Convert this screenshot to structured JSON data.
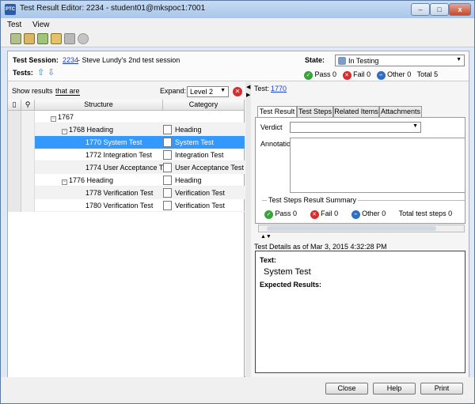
{
  "window": {
    "title": "Test Result Editor: 2234 - student01@mkspoc1:7001",
    "app_icon_label": "PTC",
    "minimize": "–",
    "maximize": "□",
    "close": "x"
  },
  "menu": {
    "items": [
      {
        "label": "Test"
      },
      {
        "label": "View"
      }
    ]
  },
  "toolbar": {
    "icons": [
      "save-icon",
      "open-icon",
      "add-icon",
      "paste-icon",
      "disabled-icon",
      "undo-icon"
    ]
  },
  "header": {
    "session_label": "Test Session:",
    "session_id": "2234",
    "session_desc": " - Steve Lundy's 2nd test session",
    "tests_label": "Tests:",
    "state_label": "State:",
    "state_value": "In Testing",
    "counts": {
      "pass_label": "Pass",
      "pass": "0",
      "fail_label": "Fail",
      "fail": "0",
      "other_label": "Other",
      "other": "0",
      "total_label": "Total",
      "total": "5"
    }
  },
  "left": {
    "show_results_label": "Show results",
    "filter_value": "that are",
    "expand_label": "Expand:",
    "expand_value": "Level 2",
    "columns": {
      "structure": "Structure",
      "category": "Category"
    },
    "rows": [
      {
        "structure": "1767",
        "category": "",
        "expander": "−"
      },
      {
        "structure": "1768 Heading",
        "category": "Heading",
        "expander": "−"
      },
      {
        "structure": "1770 System Test",
        "category": "System Test",
        "expander": ""
      },
      {
        "structure": "1772 Integration Test",
        "category": "Integration Test",
        "expander": ""
      },
      {
        "structure": "1774 User Acceptance T…",
        "category": "User Acceptance Test",
        "expander": ""
      },
      {
        "structure": "1776 Heading",
        "category": "Heading",
        "expander": "−"
      },
      {
        "structure": "1778 Verification Test",
        "category": "Verification Test",
        "expander": ""
      },
      {
        "structure": "1780 Verification Test",
        "category": "Verification Test",
        "expander": ""
      }
    ]
  },
  "right": {
    "test_label": "Test:",
    "test_id": "1770",
    "tabs": [
      "Test Result",
      "Test Steps",
      "Related Items",
      "Attachments"
    ],
    "verdict_label": "Verdict",
    "annotation_label": "Annotation",
    "summary_label": "Test Steps Result Summary",
    "summary": {
      "pass_label": "Pass",
      "pass": "0",
      "fail_label": "Fail",
      "fail": "0",
      "other_label": "Other",
      "other": "0",
      "total_label": "Total test steps",
      "total": "0"
    },
    "details_header": "Test Details as of Mar 3, 2015 4:32:28 PM",
    "text_label": "Text:",
    "text_value": "System Test",
    "expected_label": "Expected Results:"
  },
  "footer": {
    "close": "Close",
    "help": "Help",
    "print": "Print"
  }
}
